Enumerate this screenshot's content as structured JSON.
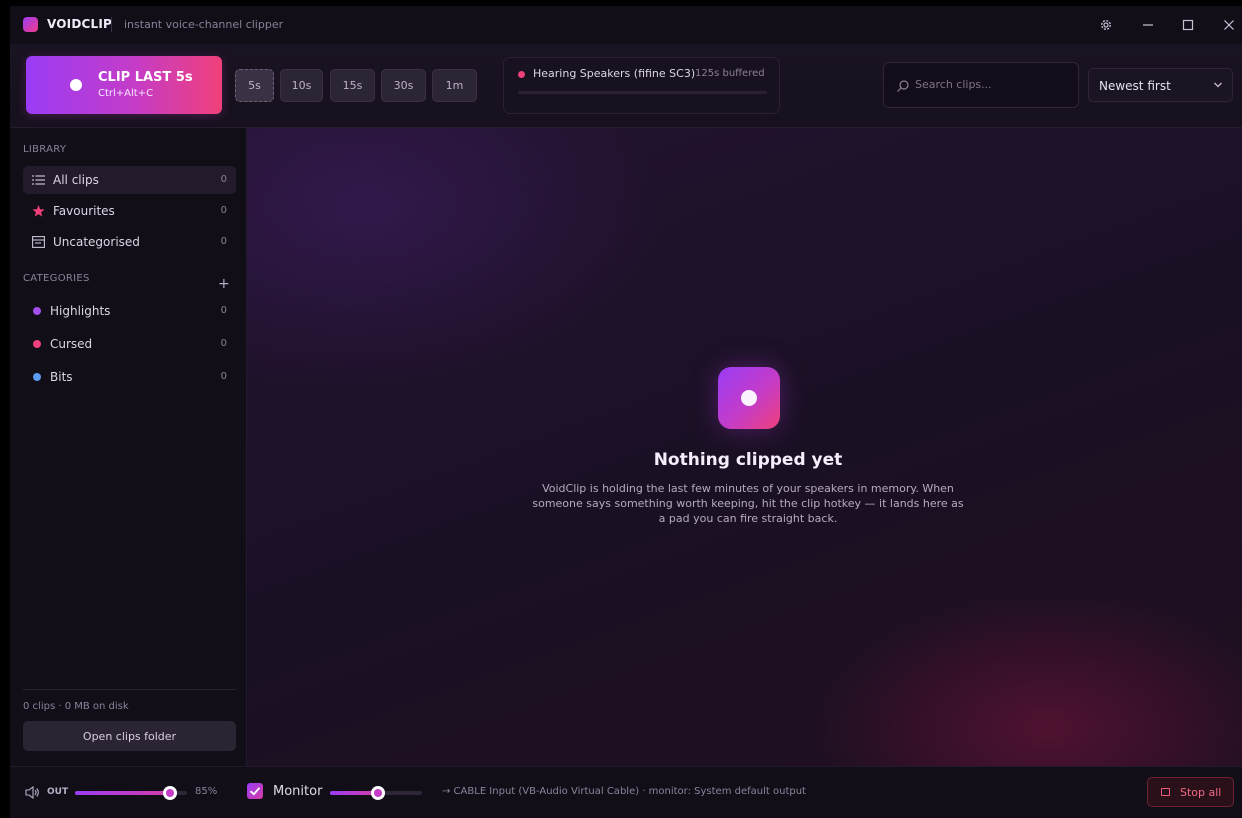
{
  "app": {
    "name": "VOIDCLIP",
    "tagline": "instant voice-channel clipper",
    "accent_from": "#9a3cf5",
    "accent_to": "#f0407a"
  },
  "window_controls": {
    "settings": "gear-icon",
    "minimize": "minimize-icon",
    "maximize": "maximize-icon",
    "close": "close-icon"
  },
  "toolbar": {
    "clip_button": {
      "label": "CLIP LAST 5s",
      "hotkey": "Ctrl+Alt+C"
    },
    "durations": [
      {
        "label": "5s",
        "selected": true
      },
      {
        "label": "10s",
        "selected": false
      },
      {
        "label": "15s",
        "selected": false
      },
      {
        "label": "30s",
        "selected": false
      },
      {
        "label": "1m",
        "selected": false
      }
    ],
    "status": {
      "device": "Hearing Speakers (fifine SC3)",
      "buffered": "125s buffered",
      "dot_color": "#f0407a"
    },
    "search": {
      "placeholder": "Search clips..."
    },
    "sort": {
      "selected": "Newest first"
    }
  },
  "sidebar": {
    "library_heading": "LIBRARY",
    "library": [
      {
        "label": "All clips",
        "count": "0",
        "icon": "list-icon",
        "active": true
      },
      {
        "label": "Favourites",
        "count": "0",
        "icon": "star-icon",
        "active": false
      },
      {
        "label": "Uncategorised",
        "count": "0",
        "icon": "inbox-icon",
        "active": false
      }
    ],
    "categories_heading": "CATEGORIES",
    "add_category": "+",
    "categories": [
      {
        "label": "Highlights",
        "count": "0",
        "color": "#a24ee8"
      },
      {
        "label": "Cursed",
        "count": "0",
        "color": "#f0407a"
      },
      {
        "label": "Bits",
        "count": "0",
        "color": "#5b9cf0"
      }
    ],
    "disk_usage": "0 clips · 0 MB on disk",
    "open_folder": "Open clips folder"
  },
  "main": {
    "empty_title": "Nothing clipped yet",
    "empty_text": "VoidClip is holding the last few minutes of your speakers in memory. When someone says something worth keeping, hit the clip hotkey — it lands here as a pad you can fire straight back."
  },
  "bottom": {
    "out_label": "OUT",
    "out_volume": "85%",
    "out_level": 0.85,
    "monitor_label": "Monitor",
    "monitor_checked": true,
    "monitor_level": 0.52,
    "route": "→ CABLE Input (VB-Audio Virtual Cable) · monitor: System default output",
    "stop_all": "Stop all"
  }
}
